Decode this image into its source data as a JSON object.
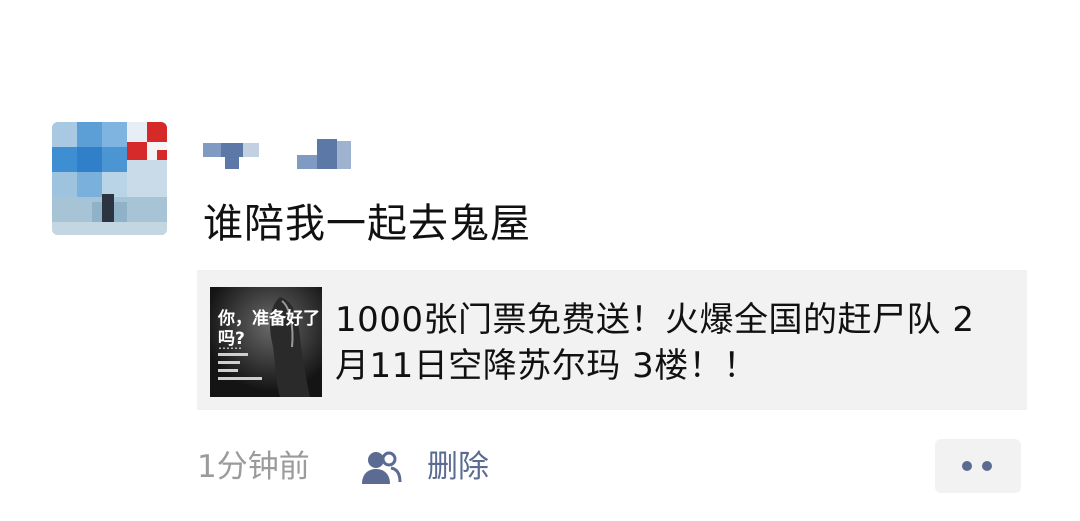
{
  "post": {
    "text": "谁陪我一起去鬼屋",
    "avatar_icon": "user-avatar-pixelated",
    "nickname_icon": "nickname-pixelated"
  },
  "link_card": {
    "title": "1000张门票免费送！火爆全国的赶尸队 2月11日空降苏尔玛 3楼！！",
    "thumbnail": {
      "headline": "你，准备好了吗?",
      "caption": "……"
    }
  },
  "footer": {
    "timestamp": "1分钟前",
    "visibility_icon": "people-icon",
    "delete_label": "删除",
    "more_icon": "more-dots-icon"
  },
  "colors": {
    "link_blue": "#5b6b92",
    "meta_gray": "#9b9b9b",
    "card_bg": "#f2f2f2"
  }
}
